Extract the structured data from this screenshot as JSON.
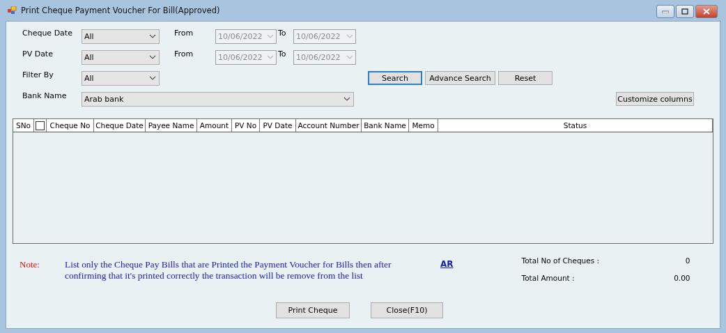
{
  "window": {
    "title": "Print Cheque Payment Voucher For Bill(Approved)"
  },
  "filters": [
    {
      "label": "Cheque Date",
      "value": "All",
      "range": {
        "from_label": "From",
        "from": "10/06/2022",
        "to_label": "To",
        "to": "10/06/2022",
        "disabled": true
      }
    },
    {
      "label": "PV Date",
      "value": "All",
      "range": {
        "from_label": "From",
        "from": "10/06/2022",
        "to_label": "To",
        "to": "10/06/2022",
        "disabled": true
      }
    },
    {
      "label": "Filter By",
      "value": "All"
    }
  ],
  "search_buttons": [
    {
      "label": "Search",
      "focused": true
    },
    {
      "label": "Advance Search",
      "focused": false
    },
    {
      "label": "Reset",
      "focused": false
    }
  ],
  "bank": {
    "label": "Bank Name",
    "value": "Arab bank"
  },
  "customize_button": "Customize columns",
  "table": {
    "columns": [
      {
        "kind": "text",
        "label": "SNo"
      },
      {
        "kind": "checkbox",
        "checked": false
      },
      {
        "kind": "text",
        "label": "Cheque No"
      },
      {
        "kind": "text",
        "label": "Cheque Date"
      },
      {
        "kind": "text",
        "label": "Payee Name"
      },
      {
        "kind": "text",
        "label": "Amount"
      },
      {
        "kind": "text",
        "label": "PV No"
      },
      {
        "kind": "text",
        "label": "PV Date"
      },
      {
        "kind": "text",
        "label": "Account Number"
      },
      {
        "kind": "text",
        "label": "Bank Name"
      },
      {
        "kind": "text",
        "label": "Memo"
      },
      {
        "kind": "text",
        "label": "Status"
      }
    ]
  },
  "note": {
    "label": "Note:",
    "text": "List only the Cheque Pay Bills that are Printed the Payment Voucher for Bills then after confirming that it's printed correctly the transaction will be remove from the list",
    "link": "AR"
  },
  "totals": [
    {
      "label": "Total No of Cheques :",
      "value": "0"
    },
    {
      "label": "Total Amount :",
      "value": "0.00"
    }
  ],
  "buttons": [
    "Print Cheque",
    "Close(F10)"
  ]
}
